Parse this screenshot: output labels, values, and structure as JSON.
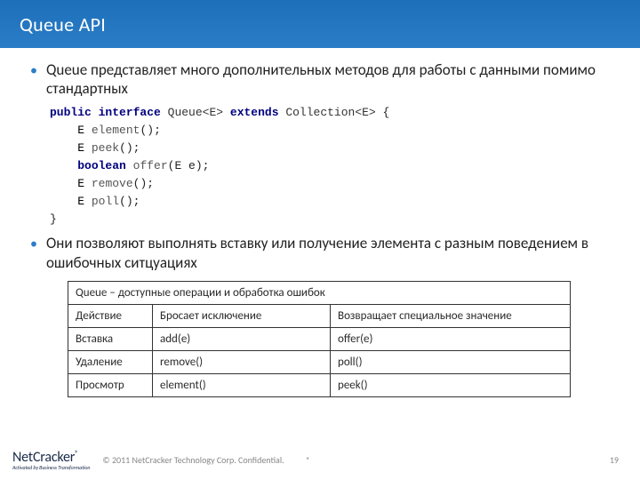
{
  "title": "Queue API",
  "bullets": [
    "Queue представляет много дополнительных методов для работы с данными помимо стандартных",
    "Они позволяют выполнять вставку или получение элемента с разным поведением в ошибочных ситцуациях"
  ],
  "code": {
    "public": "public",
    "interface": "interface",
    "queue": "Queue",
    "generic_e": "<E>",
    "extends": "extends",
    "collection": "Collection",
    "brace_open": "{",
    "brace_close": "}",
    "E": "E",
    "boolean": "boolean",
    "m_element": "element",
    "m_peek": "peek",
    "m_offer": "offer",
    "m_remove": "remove",
    "m_poll": "poll",
    "param_e": "(E e)",
    "parens": "()",
    "semi": ";"
  },
  "table": {
    "caption": "Queue – доступные операции и обработка ошибок",
    "headers": [
      "Действие",
      "Бросает исключение",
      "Возвращает специальное значение"
    ],
    "rows": [
      [
        "Вставка",
        "add(e)",
        "offer(e)"
      ],
      [
        "Удаление",
        "remove()",
        "poll()"
      ],
      [
        "Просмотр",
        "element()",
        "peek()"
      ]
    ]
  },
  "footer": {
    "logo_net": "Net",
    "logo_cracker": "Cracker",
    "logo_reg": "®",
    "logo_sub": "Activated by Business Transformation",
    "copyright": "© 2011 NetCracker Technology Corp. Confidential.",
    "asterisk": "*",
    "pagenum": "19"
  }
}
